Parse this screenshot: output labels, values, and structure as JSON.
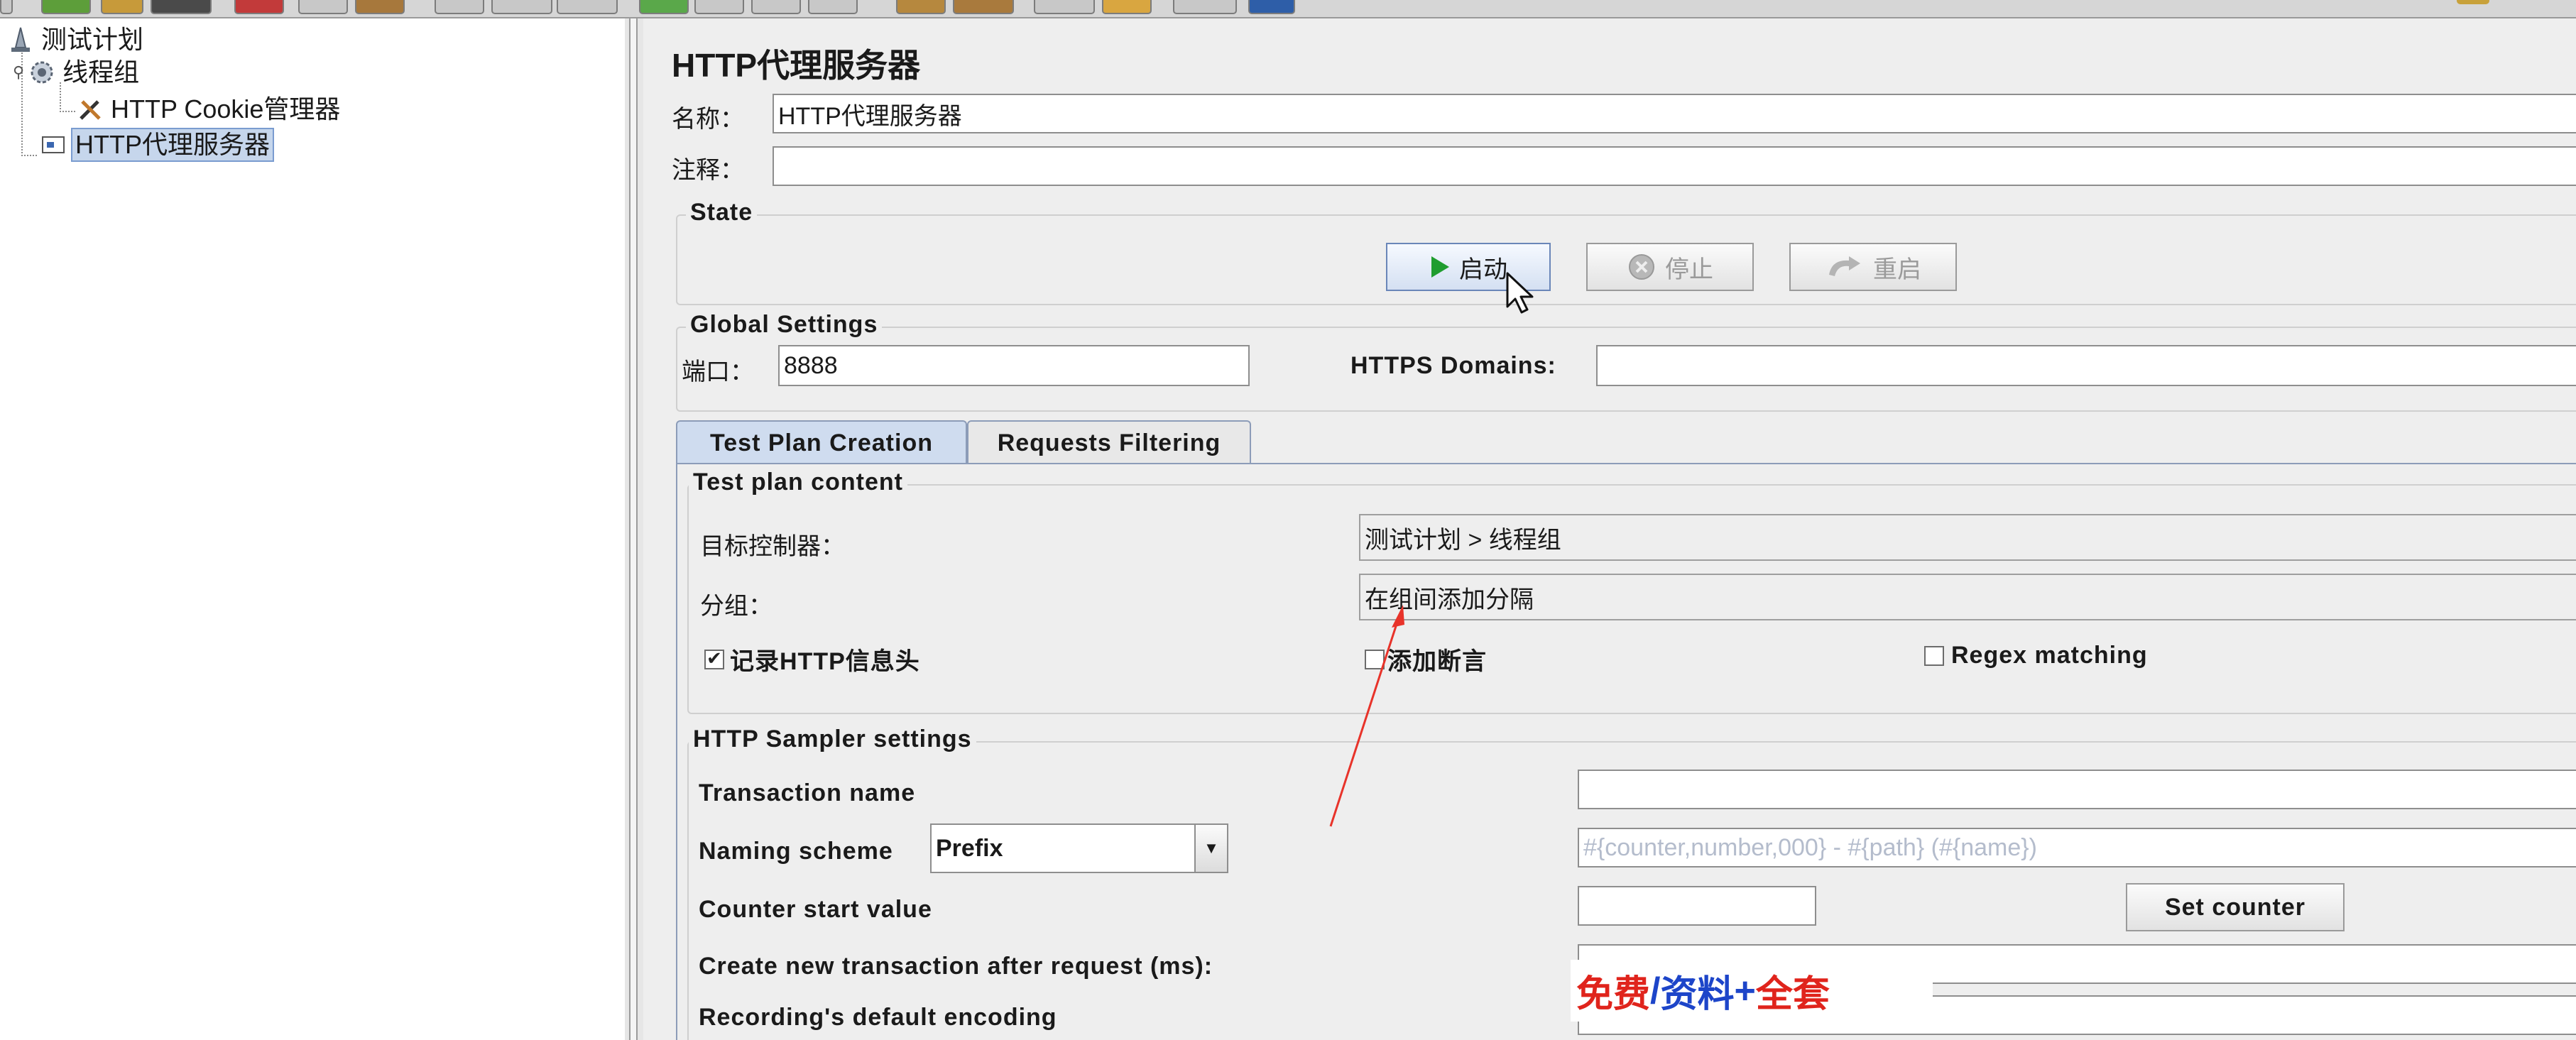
{
  "tree": {
    "items": [
      {
        "label": "测试计划",
        "icon": "test-plan-icon"
      },
      {
        "label": "线程组",
        "icon": "thread-group-gear-icon"
      },
      {
        "label": "HTTP Cookie管理器",
        "icon": "config-tools-icon"
      },
      {
        "label": "HTTP代理服务器",
        "icon": "proxy-server-icon",
        "selected": true
      }
    ]
  },
  "panel": {
    "title": "HTTP代理服务器",
    "name_label": "名称：",
    "name_value": "HTTP代理服务器",
    "comment_label": "注释：",
    "comment_value": "",
    "state": {
      "title": "State",
      "start_label": "启动",
      "stop_label": "停止",
      "restart_label": "重启"
    },
    "global": {
      "title": "Global Settings",
      "port_label": "端口：",
      "port_value": "8888",
      "https_label": "HTTPS Domains:",
      "https_value": ""
    },
    "tabs": [
      {
        "label": "Test Plan Creation",
        "active": true
      },
      {
        "label": "Requests Filtering",
        "active": false
      }
    ],
    "content": {
      "title": "Test plan content",
      "target_label": "目标控制器：",
      "target_value": "测试计划 > 线程组",
      "grouping_label": "分组：",
      "grouping_value": "在组间添加分隔",
      "record_headers_label": "记录HTTP信息头",
      "record_headers_checked": true,
      "add_assertions_label": "添加断言",
      "add_assertions_checked": false,
      "regex_label": "Regex matching",
      "regex_checked": false
    },
    "sampler": {
      "title": "HTTP Sampler settings",
      "transaction_label": "Transaction name",
      "transaction_value": "",
      "naming_label": "Naming scheme",
      "naming_value": "Prefix",
      "naming_format_placeholder": "#{counter,number,000} - #{path} (#{name})",
      "counter_label": "Counter start value",
      "counter_value": "",
      "set_counter_label": "Set counter",
      "create_tx_label": "Create new transaction after request (ms):",
      "create_tx_value": "",
      "encoding_label": "Recording's default encoding",
      "encoding_value": ""
    }
  },
  "watermark": {
    "part1": "免费",
    "sep": "/",
    "part2": "资料",
    "plus": "+",
    "part3": "全套"
  },
  "colors": {
    "selection_bg": "#c6d6ec",
    "active_tab_bg": "#cfdcef",
    "start_arrow": "#1f9d2f",
    "annotation_arrow": "#e8332a",
    "watermark_red": "#e0241c",
    "watermark_blue": "#1d45c9"
  }
}
